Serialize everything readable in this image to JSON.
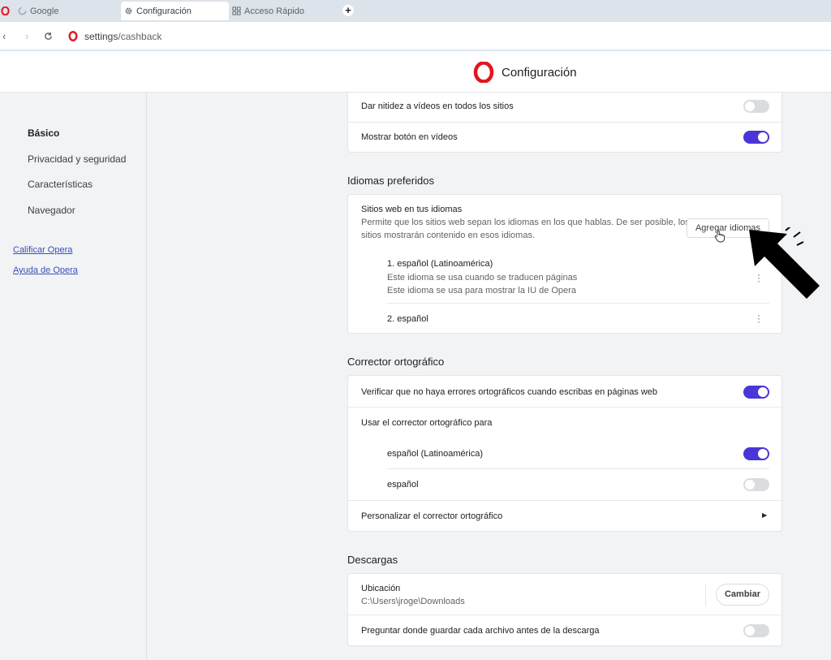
{
  "tabs": [
    {
      "label": "Google"
    },
    {
      "label": "Configuración"
    },
    {
      "label": "Acceso Rápido"
    }
  ],
  "address": {
    "host": "settings",
    "path": "/cashback"
  },
  "header": {
    "title": "Configuración"
  },
  "sidebar": {
    "items": [
      "Básico",
      "Privacidad y seguridad",
      "Características",
      "Navegador"
    ],
    "links": [
      "Calificar Opera",
      "Ayuda de Opera"
    ]
  },
  "video": {
    "sharpen": "Dar nitidez a vídeos en todos los sitios",
    "sharpen_on": false,
    "button": "Mostrar botón en vídeos",
    "button_on": true
  },
  "languages": {
    "title": "Idiomas preferidos",
    "sites_title": "Sitios web en tus idiomas",
    "sites_desc_1": "Permite que los sitios web sepan los idiomas en los que hablas. De ser posible, los",
    "sites_desc_2": "sitios mostrarán contenido en esos idiomas.",
    "add_button": "Agregar idiomas",
    "list": [
      {
        "name": "1. español (Latinoamérica)",
        "note1": "Este idioma se usa cuando se traducen páginas",
        "note2": "Este idioma se usa para mostrar la IU de Opera"
      },
      {
        "name": "2. español"
      }
    ]
  },
  "spellcheck": {
    "title": "Corrector ortográfico",
    "verify": "Verificar que no haya errores ortográficos cuando escribas en páginas web",
    "verify_on": true,
    "use_for": "Usar el corrector ortográfico para",
    "langs": [
      {
        "name": "español (Latinoamérica)",
        "on": true
      },
      {
        "name": "español",
        "on": false
      }
    ],
    "customize": "Personalizar el corrector ortográfico"
  },
  "downloads": {
    "title": "Descargas",
    "location_label": "Ubicación",
    "location_value": "C:\\Users\\jroge\\Downloads",
    "change_button": "Cambiar",
    "ask": "Preguntar donde guardar cada archivo antes de la descarga",
    "ask_on": false
  },
  "colors": {
    "accent": "#4a35d8",
    "opera_red": "#e2151e"
  }
}
